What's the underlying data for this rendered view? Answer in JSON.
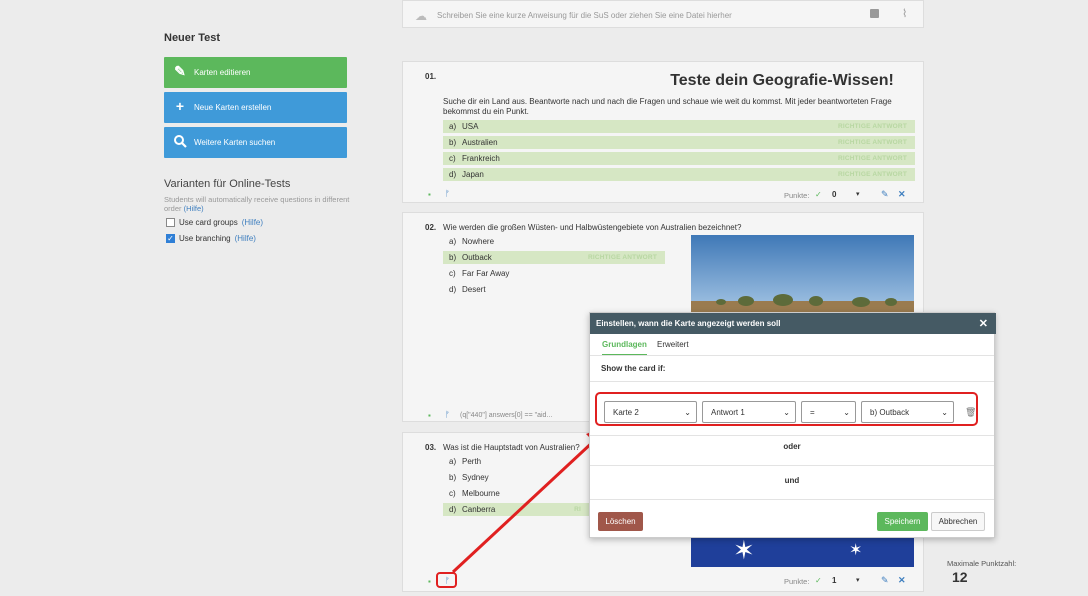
{
  "sidebar": {
    "title": "Neuer Test",
    "buttons": [
      {
        "label": "Karten editieren",
        "icon": "pencil-icon"
      },
      {
        "label": "Neue Karten erstellen",
        "icon": "plus-icon"
      },
      {
        "label": "Weitere Karten suchen",
        "icon": "search-icon"
      }
    ],
    "variants_title": "Varianten für Online-Tests",
    "variants_desc": "Students will automatically receive questions in different order",
    "variants_help": "(Hilfe)",
    "options": [
      {
        "label": "Use card groups",
        "help": "(Hilfe)",
        "checked": false
      },
      {
        "label": "Use branching",
        "help": "(Hilfe)",
        "checked": true
      }
    ]
  },
  "top_bar": {
    "instruction_placeholder": "Schreiben Sie eine kurze Anweisung für die SuS oder ziehen Sie eine Datei hierher"
  },
  "cards": [
    {
      "number": "01.",
      "title": "Teste dein Geografie-Wissen!",
      "text": "Suche dir ein Land aus. Beantworte nach und nach die Fragen und schaue wie weit du kommst. Mit jeder beantworteten Frage bekommst du ein Punkt.",
      "answers": [
        {
          "letter": "a)",
          "text": "USA",
          "badge": "RICHTIGE ANTWORT"
        },
        {
          "letter": "b)",
          "text": "Australien",
          "badge": "RICHTIGE ANTWORT"
        },
        {
          "letter": "c)",
          "text": "Frankreich",
          "badge": "RICHTIGE ANTWORT"
        },
        {
          "letter": "d)",
          "text": "Japan",
          "badge": "RICHTIGE ANTWORT"
        }
      ],
      "punkte_label": "Punkte:",
      "punkte": "0"
    },
    {
      "number": "02.",
      "question": "Wie werden die großen Wüsten- und Halbwüstengebiete von Australien bezeichnet?",
      "answers": [
        {
          "letter": "a)",
          "text": "Nowhere"
        },
        {
          "letter": "b)",
          "text": "Outback",
          "badge": "RICHTIGE ANTWORT"
        },
        {
          "letter": "c)",
          "text": "Far Far Away"
        },
        {
          "letter": "d)",
          "text": "Desert"
        }
      ],
      "condition": "(q[\"440\"] answers[0] == \"aid..."
    },
    {
      "number": "03.",
      "question": "Was ist die Hauptstadt von Australien?",
      "answers": [
        {
          "letter": "a)",
          "text": "Perth"
        },
        {
          "letter": "b)",
          "text": "Sydney"
        },
        {
          "letter": "c)",
          "text": "Melbourne"
        },
        {
          "letter": "d)",
          "text": "Canberra",
          "badge": "RI"
        }
      ],
      "punkte_label": "Punkte:",
      "punkte": "1"
    }
  ],
  "max_points": {
    "label": "Maximale Punktzahl:",
    "value": "12"
  },
  "modal": {
    "title": "Einstellen, wann die Karte angezeigt werden soll",
    "tabs": [
      "Grundlagen",
      "Erweitert"
    ],
    "show_if": "Show the card if:",
    "selects": [
      "Karte 2",
      "Antwort 1",
      "=",
      "b) Outback"
    ],
    "oder": "oder",
    "und": "und",
    "delete_label": "Löschen",
    "save_label": "Speichern",
    "cancel_label": "Abbrechen"
  },
  "colors": {
    "green": "#5cb85c",
    "blue": "#3f9ad9",
    "modal_header": "#455a64",
    "highlight_red": "#e02020"
  }
}
